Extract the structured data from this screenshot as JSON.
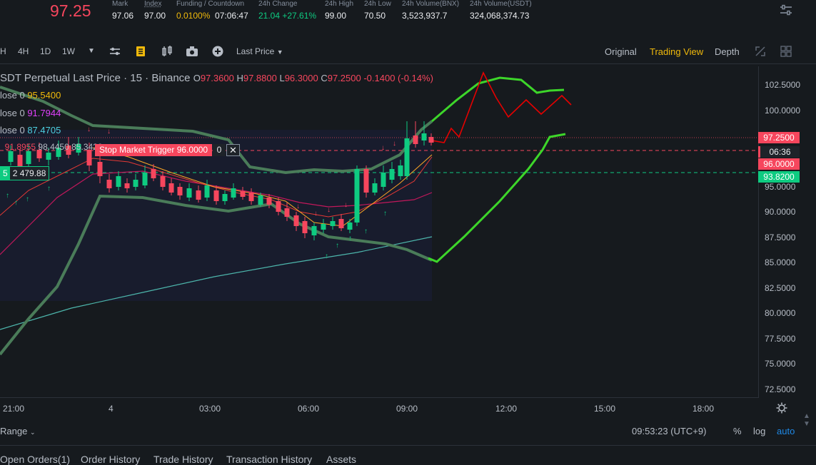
{
  "header": {
    "last_price": "97.25",
    "stats": [
      {
        "label": "Mark",
        "value": "97.06",
        "value_color": "#eaecef"
      },
      {
        "label": "Index",
        "value": "97.00",
        "value_color": "#eaecef"
      },
      {
        "label": "Funding / Countdown",
        "value": "0.0100%",
        "value2": "07:06:47",
        "value_color": "#f0b90b"
      },
      {
        "label": "24h Change",
        "value": "21.04 +27.61%",
        "value_color": "#0ecb81"
      },
      {
        "label": "24h High",
        "value": "99.00",
        "value_color": "#eaecef"
      },
      {
        "label": "24h Low",
        "value": "70.50",
        "value_color": "#eaecef"
      },
      {
        "label": "24h Volume(BNX)",
        "value": "3,523,937.7",
        "value_color": "#eaecef"
      },
      {
        "label": "24h Volume(USDT)",
        "value": "324,068,374.73",
        "value_color": "#eaecef"
      }
    ]
  },
  "toolbar": {
    "intervals": [
      "H",
      "4H",
      "1D",
      "1W"
    ],
    "price_type": "Last Price",
    "views": [
      "Original",
      "Trading View",
      "Depth"
    ],
    "active_view": "Trading View"
  },
  "chart": {
    "legend_title": "SDT Perpetual Last Price · 15 · Binance",
    "ohlc": {
      "o": "97.3600",
      "h": "97.8800",
      "l": "96.3000",
      "c": "97.2500",
      "chg": "-0.1400 (-0.14%)"
    },
    "indicators": [
      {
        "label": "lose 0",
        "value": "95.5400",
        "color": "#f0b90b"
      },
      {
        "label": "lose 0",
        "value": "91.7944",
        "color": "#e040fb"
      },
      {
        "label": "lose 0",
        "value": "87.4705",
        "color": "#4dd0e1"
      }
    ],
    "bb_values": {
      "upper": "98.4450",
      "lower": "85.3420"
    },
    "trigger": {
      "label": "Stop Market Trigger 96.0000",
      "qty": "0"
    },
    "current_tag": {
      "left": "5",
      "value": "2 479.88"
    },
    "yaxis_ticks": [
      "102.5000",
      "100.0000",
      "97.5000",
      "95.0000",
      "92.5000",
      "90.0000",
      "87.5000",
      "85.0000",
      "82.5000",
      "80.0000",
      "77.5000",
      "75.0000",
      "72.5000"
    ],
    "price_tags": [
      {
        "value": "97.2500",
        "color": "#f6465d"
      },
      {
        "value": "06:36",
        "color": "#f6465d"
      },
      {
        "value": "96.0000",
        "color": "#f6465d"
      },
      {
        "value": "93.8200",
        "color": "#0ecb81"
      }
    ],
    "xaxis_ticks": [
      "21:00",
      "4",
      "03:00",
      "06:00",
      "09:00",
      "12:00",
      "15:00",
      "18:00"
    ]
  },
  "bottom": {
    "range_label": "Range",
    "clock": "09:53:23 (UTC+9)",
    "pct": "%",
    "log": "log",
    "auto": "auto"
  },
  "tabs": [
    "Open Orders(1)",
    "Order History",
    "Trade History",
    "Transaction History",
    "Assets"
  ]
}
